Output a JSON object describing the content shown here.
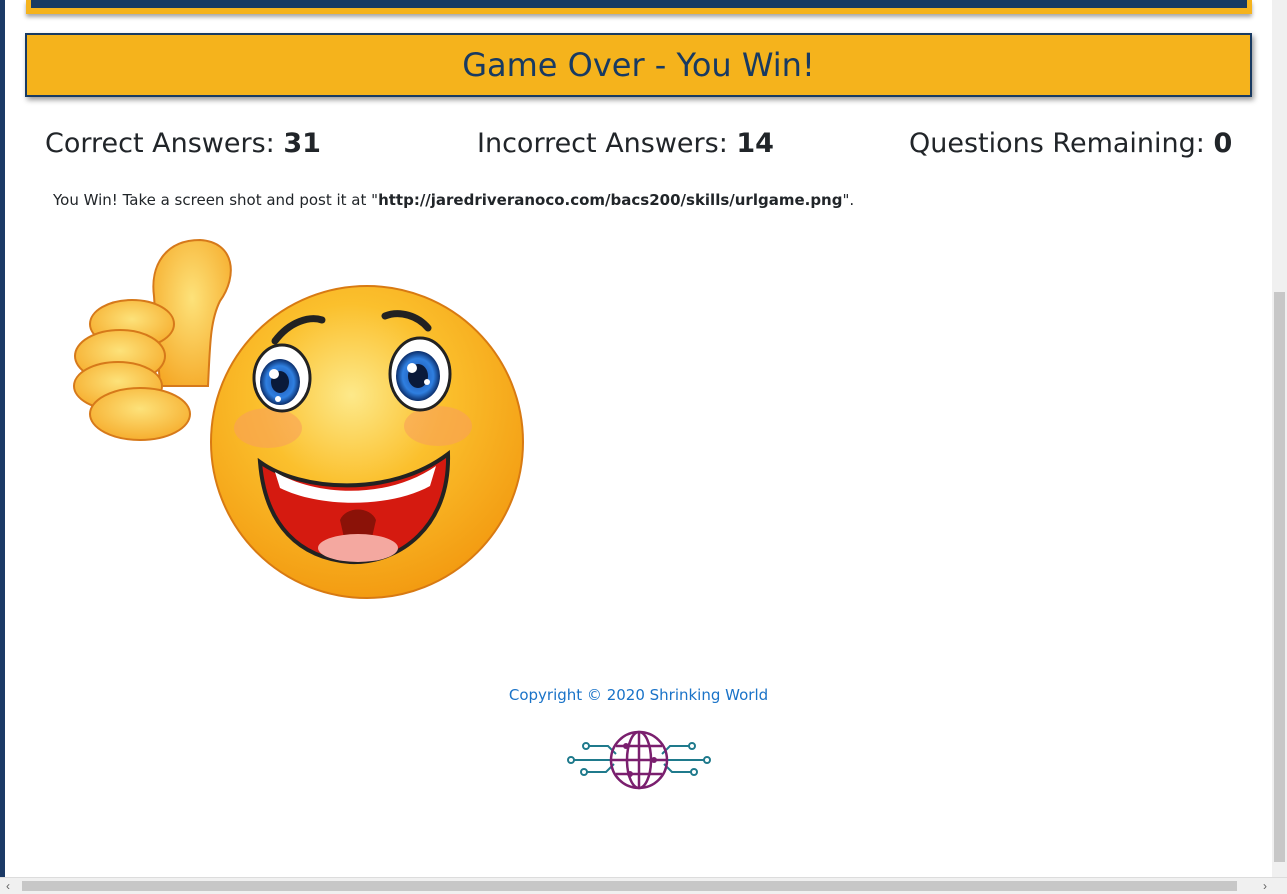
{
  "title": "Game Over - You Win!",
  "stats": {
    "correct_label": "Correct Answers: ",
    "correct_value": "31",
    "incorrect_label": "Incorrect Answers: ",
    "incorrect_value": "14",
    "remaining_label": "Questions Remaining: ",
    "remaining_value": "0"
  },
  "message": {
    "prefix": "You Win! Take a screen shot and post it at \"",
    "url": "http://jaredriveranoco.com/bacs200/skills/urlgame.png",
    "suffix": "\"."
  },
  "image": {
    "name": "thumbs-up-smiley"
  },
  "footer": {
    "copyright": "Copyright © 2020 Shrinking World",
    "logo": "globe-circuit-logo"
  },
  "colors": {
    "banner": "#f5b31c",
    "navy": "#183a62",
    "link": "#1a73c8"
  }
}
